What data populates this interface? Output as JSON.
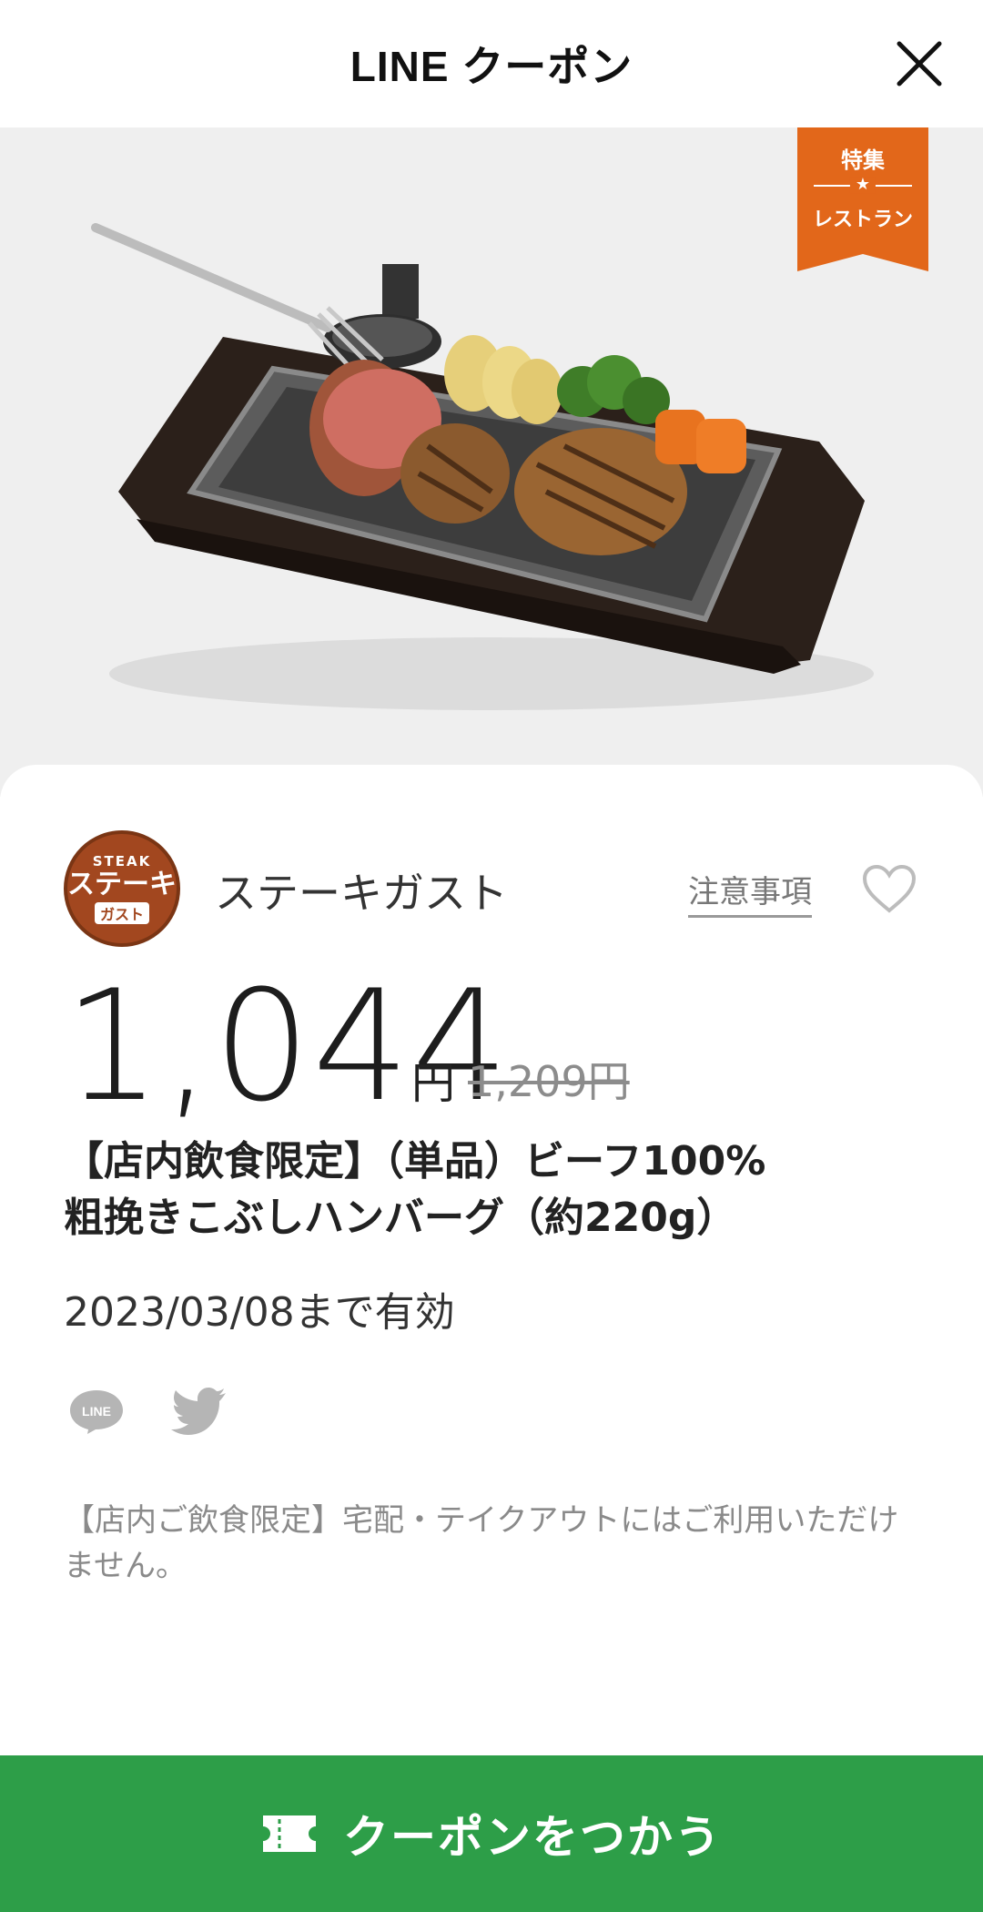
{
  "header": {
    "title": "LINE クーポン"
  },
  "badge": {
    "top": "特集",
    "star": "★",
    "bottom": "レストラン"
  },
  "store": {
    "logo": {
      "top": "STEAK",
      "main": "ステーキ",
      "sub": "ガスト"
    },
    "name": "ステーキガスト"
  },
  "notes_link": "注意事項",
  "price": {
    "value": "1,044",
    "unit": "円",
    "original": "1,209円"
  },
  "coupon": {
    "title_line1": "【店内飲食限定】（単品）ビーフ100%",
    "title_line2": "粗挽きこぶしハンバーグ（約220g）",
    "validity": "2023/03/08まで有効"
  },
  "share": {
    "line_label": "LINE"
  },
  "notice": "【店内ご飲食限定】宅配・テイクアウトにはご利用いただけません。",
  "cta": {
    "label": "クーポンをつかう"
  },
  "colors": {
    "accent_green": "#2d9e48",
    "badge_orange": "#e2671a"
  }
}
